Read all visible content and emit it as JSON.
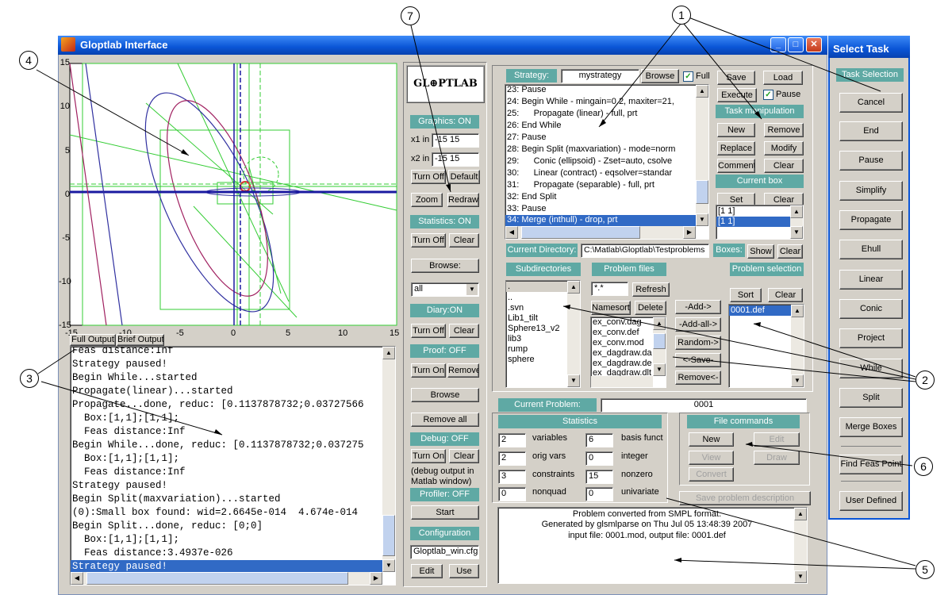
{
  "window": {
    "title": "Gloptlab Interface"
  },
  "plot": {
    "xticks": [
      "-15",
      "-10",
      "-5",
      "0",
      "5",
      "10",
      "15"
    ],
    "yticks": [
      "15",
      "10",
      "5",
      "0",
      "-5",
      "-10",
      "-15"
    ]
  },
  "output": {
    "full_label": "Full Output",
    "brief_label": "Brief Output",
    "lines": [
      "Feas distance:Inf",
      "Strategy paused!",
      "Begin While...started",
      "Propagate(linear)...started",
      "Propagate...done, reduc: [0.1137878732;0.03727566",
      "  Box:[1,1];[1,1];",
      "  Feas distance:Inf",
      "Begin While...done, reduc: [0.1137878732;0.037275",
      "  Box:[1,1];[1,1];",
      "  Feas distance:Inf",
      "Strategy paused!",
      "Begin Split(maxvariation)...started",
      "(0):Small box found: wid=2.6645e-014  4.674e-014",
      "Begin Split...done, reduc: [0;0]",
      "  Box:[1,1];[1,1];",
      "  Feas distance:3.4937e-026",
      "Strategy paused!"
    ]
  },
  "middle": {
    "logo": "GL⊕PTLAB",
    "graphics_status": "Graphics: ON",
    "x1_label": "x1 in",
    "x1_value": "-15 15",
    "x2_label": "x2 in",
    "x2_value": "-15 15",
    "turn_off": "Turn Off",
    "default": "Default",
    "zoom": "Zoom",
    "redraw": "Redraw",
    "statistics_status": "Statistics: ON",
    "clear": "Clear",
    "browse_label": "Browse:",
    "browse_select": "all",
    "diary_status": "Diary:ON",
    "proof_status": "Proof: OFF",
    "turn_on": "Turn On",
    "remove": "Remove",
    "browse": "Browse",
    "remove_all": "Remove all",
    "debug_status": "Debug: OFF",
    "debug_note1": "(debug output in",
    "debug_note2": "Matlab window)",
    "profiler_status": "Profiler: OFF",
    "start": "Start",
    "configuration": "Configuration",
    "config_file": "Gloptlab_win.cfg",
    "edit": "Edit",
    "use": "Use"
  },
  "strategy": {
    "label": "Strategy:",
    "name": "mystrategy",
    "browse": "Browse",
    "full_label": "Full",
    "lines": [
      "23: Pause",
      "24: Begin While - mingain=0.2, maxiter=21,",
      "25:      Propagate (linear) - full, prt",
      "26: End While",
      "27: Pause",
      "28: Begin Split (maxvariation) - mode=norm",
      "29:      Conic (ellipsoid) - Zset=auto, csolve",
      "30:      Linear (contract) - eqsolver=standar",
      "31:      Propagate (separable) - full, prt",
      "32: End Split",
      "33: Pause",
      "34: Merge (inthull) - drop, prt"
    ],
    "save": "Save",
    "load": "Load",
    "execute": "Execute",
    "pause": "Pause",
    "task_manipulation": "Task manipulation",
    "new": "New",
    "remove": "Remove",
    "replace": "Replace",
    "modify": "Modify",
    "comment": "Comment",
    "clear": "Clear",
    "current_box": "Current box",
    "set": "Set",
    "box_lines": [
      "[1  1]",
      "[1  1]"
    ]
  },
  "directory": {
    "label": "Current Directory:",
    "path": "C:\\Matlab\\Gloptlab\\Testproblems",
    "boxes_label": "Boxes:",
    "show": "Show",
    "clear": "Clear",
    "subdirs_header": "Subdirectories",
    "subdirs": [
      ".",
      "..",
      ".svn",
      "Lib1_tilt",
      "Sphere13_v2",
      "lib3",
      "rump",
      "sphere"
    ],
    "files_header": "Problem files",
    "filter": "*.*",
    "refresh": "Refresh",
    "namesort": "Namesort",
    "delete": "Delete",
    "files": [
      "ex_conv.dag",
      "ex_conv.def",
      "ex_conv.mod",
      "ex_dagdraw.da",
      "ex_dagdraw.de",
      "ex_dagdraw.dlt"
    ],
    "add": "-Add->",
    "add_all": "-Add-all->",
    "random": "Random->",
    "save": "<-Save-",
    "remove": "Remove<-",
    "selection_header": "Problem selection",
    "sort": "Sort",
    "sel_clear": "Clear",
    "selection": [
      "0001.def"
    ]
  },
  "problem": {
    "label": "Current Problem:",
    "value": "0001",
    "stats_header": "Statistics",
    "stats": [
      {
        "v1": "2",
        "l1": "variables",
        "v2": "6",
        "l2": "basis funct"
      },
      {
        "v1": "2",
        "l1": "orig vars",
        "v2": "0",
        "l2": "integer"
      },
      {
        "v1": "3",
        "l1": "constraints",
        "v2": "15",
        "l2": "nonzero"
      },
      {
        "v1": "0",
        "l1": "nonquad",
        "v2": "0",
        "l2": "univariate"
      }
    ],
    "file_commands": "File commands",
    "new": "New",
    "edit": "Edit",
    "view": "View",
    "draw": "Draw",
    "convert": "Convert",
    "save_desc": "Save problem description",
    "desc_lines": [
      "Problem converted from SMPL format.",
      "Generated by glsmlparse on Thu Jul 05 13:48:39 2007",
      "input file: 0001.mod, output file: 0001.def"
    ]
  },
  "select_task": {
    "title": "Select Task",
    "header": "Task Selection",
    "buttons": [
      "Cancel",
      "End",
      "Pause",
      "Simplify",
      "Propagate",
      "Ehull",
      "Linear",
      "Conic",
      "Project",
      "While",
      "Split",
      "Merge Boxes",
      "Find Feas Point",
      "User Defined"
    ]
  },
  "callouts": [
    "1",
    "2",
    "3",
    "4",
    "5",
    "6",
    "7"
  ]
}
